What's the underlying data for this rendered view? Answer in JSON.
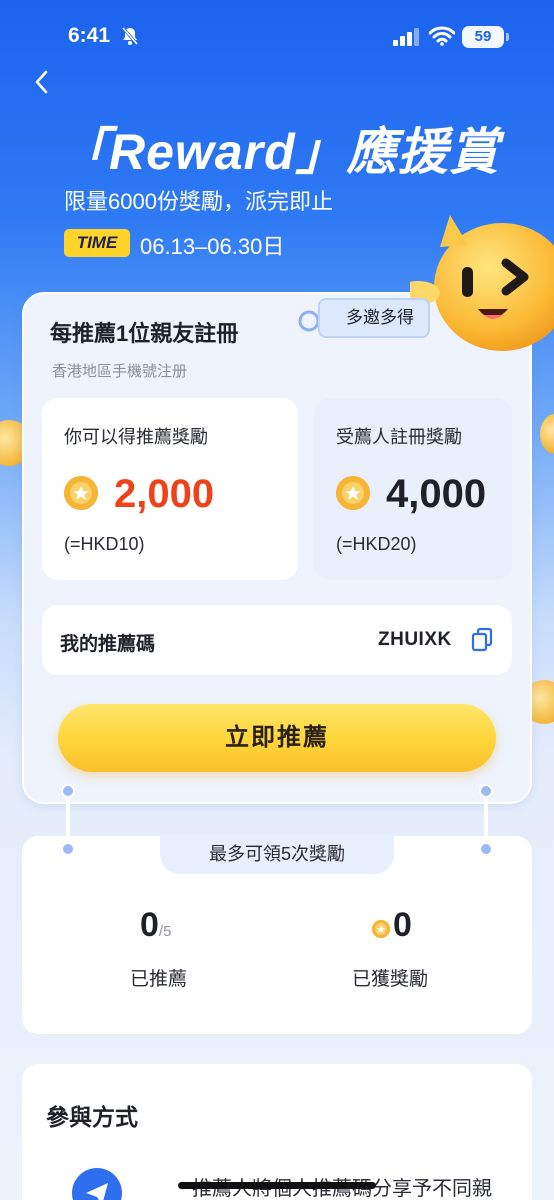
{
  "status_bar": {
    "time": "6:41",
    "battery": "59"
  },
  "hero": {
    "title": "「Reward」應援賞",
    "subtitle": "限量6000份獎勵，派完即止",
    "time_badge": "TIME",
    "date_range": "06.13–06.30日"
  },
  "referral_card": {
    "title": "每推薦1位親友註冊",
    "subtitle": "香港地區手機號注册",
    "tag": "多邀多得",
    "you_get": {
      "label": "你可以得推薦獎勵",
      "value": "2,000",
      "equivalent": "(=HKD10)",
      "color": "#f0421a"
    },
    "referee_gets": {
      "label": "受薦人註冊獎勵",
      "value": "4,000",
      "equivalent": "(=HKD20)"
    },
    "code_label": "我的推薦碼",
    "code_value": "ZHUIXK",
    "cta": "立即推薦"
  },
  "stats": {
    "tab": "最多可領5次獎勵",
    "referred_count": "0",
    "referred_max": "/5",
    "referred_label": "已推薦",
    "rewards_count": "0",
    "rewards_label": "已獲獎勵"
  },
  "participation": {
    "title": "參與方式",
    "step1_text": "推薦人將個人推薦碼分享予不同親"
  },
  "colors": {
    "primary_blue": "#1c63ee",
    "accent_yellow": "#ffd42a",
    "reward_red": "#f0421a"
  },
  "icons": [
    "back-icon",
    "bell-muted-icon",
    "signal-icon",
    "wifi-icon",
    "star-coin-icon",
    "copy-icon",
    "send-icon"
  ]
}
